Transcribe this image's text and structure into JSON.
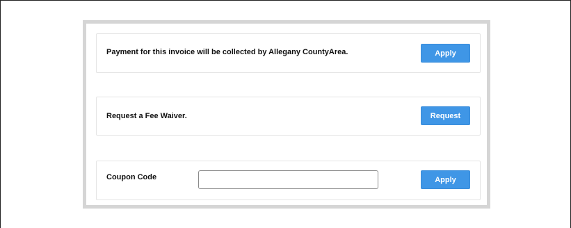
{
  "payment_card": {
    "message": "Payment for this invoice will be collected by Allegany CountyArea.",
    "button_label": "Apply"
  },
  "waiver_card": {
    "message": "Request a Fee Waiver.",
    "button_label": "Request"
  },
  "coupon_card": {
    "label": "Coupon Code",
    "input_value": "",
    "input_placeholder": "",
    "button_label": "Apply"
  },
  "colors": {
    "button_bg": "#3f96e6",
    "outer_border": "#d5d5d5",
    "card_border": "#e4e4e4"
  }
}
